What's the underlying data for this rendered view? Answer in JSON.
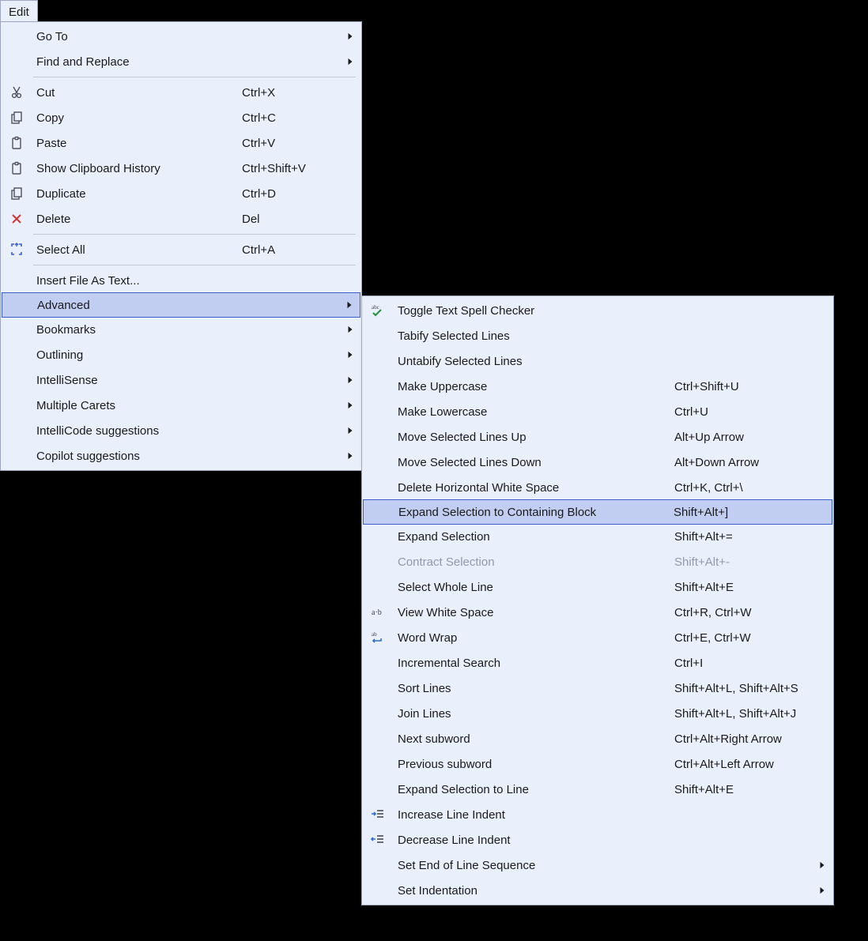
{
  "menubar": {
    "edit": "Edit"
  },
  "edit_menu": {
    "items": [
      {
        "label": "Go To",
        "submenu": true
      },
      {
        "label": "Find and Replace",
        "submenu": true
      },
      {
        "type": "sep"
      },
      {
        "label": "Cut",
        "shortcut": "Ctrl+X",
        "icon": "cut"
      },
      {
        "label": "Copy",
        "shortcut": "Ctrl+C",
        "icon": "copy"
      },
      {
        "label": "Paste",
        "shortcut": "Ctrl+V",
        "icon": "paste"
      },
      {
        "label": "Show Clipboard History",
        "shortcut": "Ctrl+Shift+V",
        "icon": "paste"
      },
      {
        "label": "Duplicate",
        "shortcut": "Ctrl+D",
        "icon": "copy"
      },
      {
        "label": "Delete",
        "shortcut": "Del",
        "icon": "delete"
      },
      {
        "type": "sep"
      },
      {
        "label": "Select All",
        "shortcut": "Ctrl+A",
        "icon": "selectall"
      },
      {
        "type": "sep"
      },
      {
        "label": "Insert File As Text..."
      },
      {
        "label": "Advanced",
        "submenu": true,
        "highlight": true
      },
      {
        "label": "Bookmarks",
        "submenu": true
      },
      {
        "label": "Outlining",
        "submenu": true
      },
      {
        "label": "IntelliSense",
        "submenu": true
      },
      {
        "label": "Multiple Carets",
        "submenu": true
      },
      {
        "label": "IntelliCode suggestions",
        "submenu": true
      },
      {
        "label": "Copilot suggestions",
        "submenu": true
      }
    ]
  },
  "advanced_submenu": {
    "items": [
      {
        "label": "Toggle Text Spell Checker",
        "icon": "spell"
      },
      {
        "label": "Tabify Selected Lines"
      },
      {
        "label": "Untabify Selected Lines"
      },
      {
        "label": "Make Uppercase",
        "shortcut": "Ctrl+Shift+U"
      },
      {
        "label": "Make Lowercase",
        "shortcut": "Ctrl+U"
      },
      {
        "label": "Move Selected Lines Up",
        "shortcut": "Alt+Up Arrow"
      },
      {
        "label": "Move Selected Lines Down",
        "shortcut": "Alt+Down Arrow"
      },
      {
        "label": "Delete Horizontal White Space",
        "shortcut": "Ctrl+K, Ctrl+\\"
      },
      {
        "label": "Expand Selection to Containing Block",
        "shortcut": "Shift+Alt+]",
        "highlight": true
      },
      {
        "label": "Expand Selection",
        "shortcut": "Shift+Alt+="
      },
      {
        "label": "Contract Selection",
        "shortcut": "Shift+Alt+-",
        "disabled": true
      },
      {
        "label": "Select Whole Line",
        "shortcut": "Shift+Alt+E"
      },
      {
        "label": "View White Space",
        "shortcut": "Ctrl+R, Ctrl+W",
        "icon": "whitespace"
      },
      {
        "label": "Word Wrap",
        "shortcut": "Ctrl+E, Ctrl+W",
        "icon": "wrap"
      },
      {
        "label": "Incremental Search",
        "shortcut": "Ctrl+I"
      },
      {
        "label": "Sort Lines",
        "shortcut": "Shift+Alt+L, Shift+Alt+S"
      },
      {
        "label": "Join Lines",
        "shortcut": "Shift+Alt+L, Shift+Alt+J"
      },
      {
        "label": "Next subword",
        "shortcut": "Ctrl+Alt+Right Arrow"
      },
      {
        "label": "Previous subword",
        "shortcut": "Ctrl+Alt+Left Arrow"
      },
      {
        "label": "Expand Selection to Line",
        "shortcut": "Shift+Alt+E"
      },
      {
        "label": "Increase Line Indent",
        "icon": "indent"
      },
      {
        "label": "Decrease Line Indent",
        "icon": "outdent"
      },
      {
        "label": "Set End of Line Sequence",
        "submenu": true
      },
      {
        "label": "Set Indentation",
        "submenu": true
      }
    ]
  }
}
